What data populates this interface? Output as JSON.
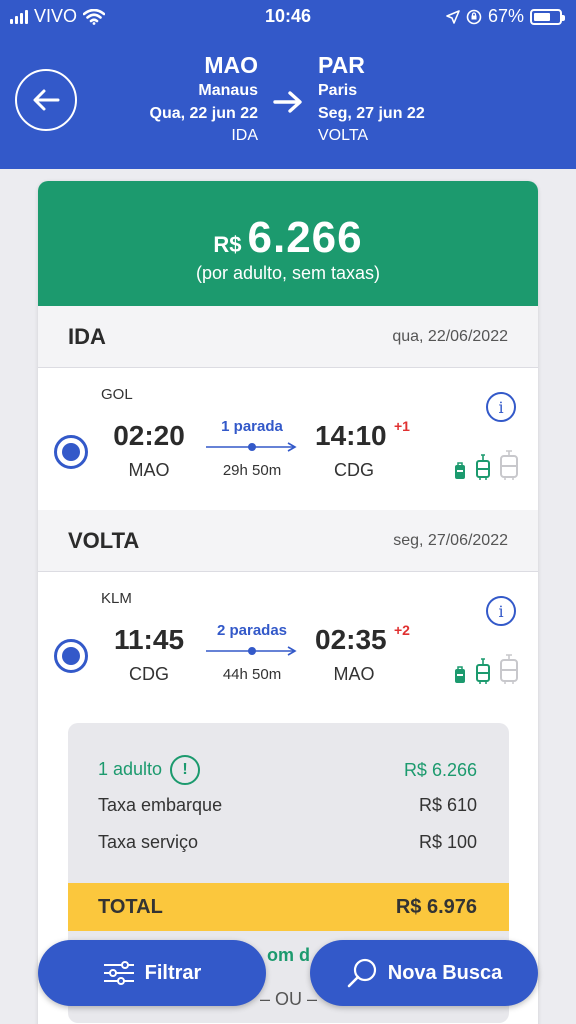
{
  "status_bar": {
    "carrier": "VIVO",
    "time": "10:46",
    "battery": "67%",
    "battery_level": 0.67
  },
  "header": {
    "origin": {
      "code": "MAO",
      "city": "Manaus",
      "date": "Qua, 22 jun 22",
      "direction": "IDA"
    },
    "destination": {
      "code": "PAR",
      "city": "Paris",
      "date": "Seg, 27 jun 22",
      "direction": "VOLTA"
    },
    "back_icon": "arrow-left-icon",
    "route_icon": "arrow-right-icon"
  },
  "price": {
    "currency": "R$",
    "amount": "6.266",
    "note": "(por adulto, sem taxas)"
  },
  "outbound": {
    "title": "IDA",
    "date": "qua, 22/06/2022",
    "airline": "GOL",
    "departure_time": "02:20",
    "departure_code": "MAO",
    "stops": "1 parada",
    "duration": "29h 50m",
    "arrival_time": "14:10",
    "day_offset": "+1",
    "arrival_code": "CDG",
    "info_icon": "i"
  },
  "return": {
    "title": "VOLTA",
    "date": "seg, 27/06/2022",
    "airline": "KLM",
    "departure_time": "11:45",
    "departure_code": "CDG",
    "stops": "2 paradas",
    "duration": "44h 50m",
    "arrival_time": "02:35",
    "day_offset": "+2",
    "arrival_code": "MAO",
    "info_icon": "i"
  },
  "summary": {
    "adults_label": "1 adulto",
    "adults_value": "R$ 6.266",
    "alert_icon": "!",
    "boarding_fee_label": "Taxa embarque",
    "boarding_fee_value": "R$ 610",
    "service_fee_label": "Taxa serviço",
    "service_fee_value": "R$ 100",
    "total_label": "TOTAL",
    "total_value": "R$ 6.976",
    "partial_text": "om d",
    "or_text": "– OU –"
  },
  "buttons": {
    "filter": "Filtrar",
    "new_search": "Nova Busca"
  },
  "colors": {
    "primary_blue": "#3359c9",
    "green": "#1c9a6e",
    "yellow": "#fbc73d",
    "red": "#e03131"
  }
}
